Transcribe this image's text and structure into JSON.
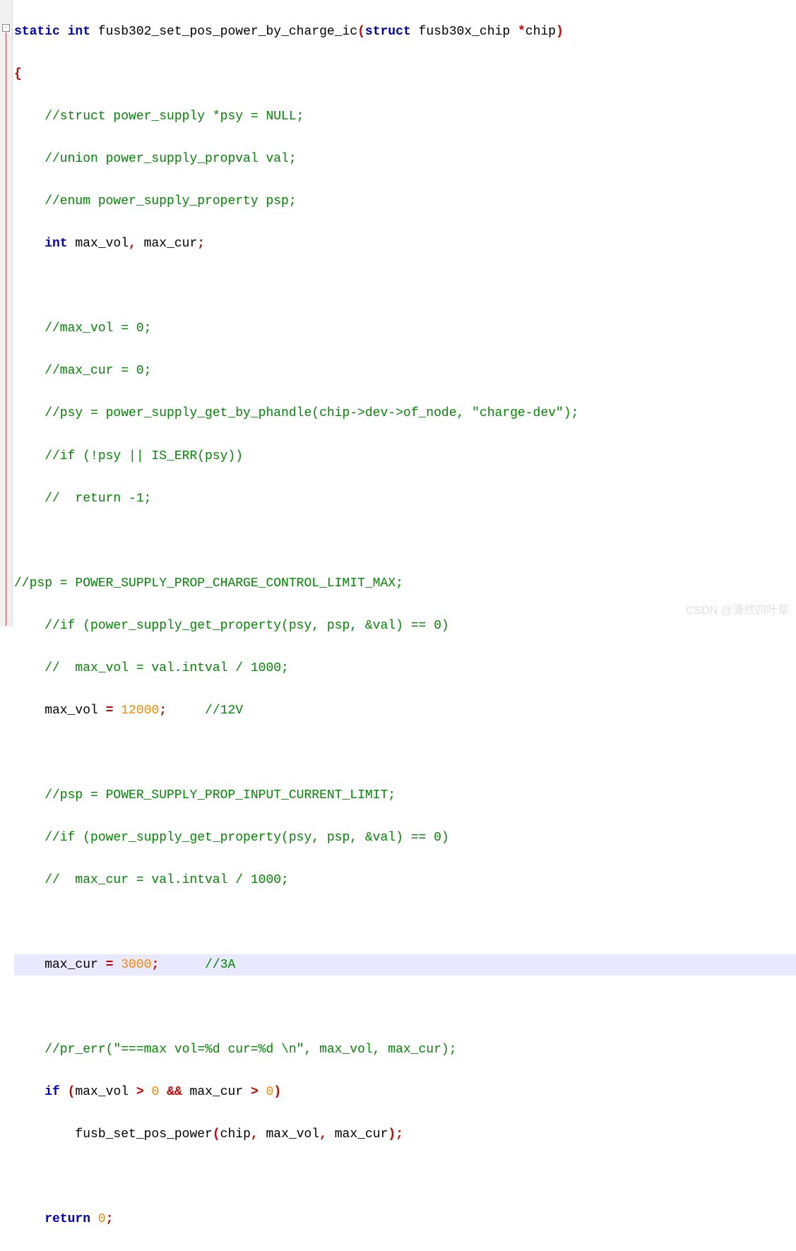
{
  "lines": {
    "l01_static": "static",
    "l01_int": " int",
    "l01_fn": " fusb302_set_pos_power_by_charge_ic",
    "l01_punc1": "(",
    "l01_struct": "struct",
    "l01_type": " fusb30x_chip ",
    "l01_star": "*",
    "l01_param": "chip",
    "l01_punc2": ")",
    "l02_brace": "{",
    "l03": "    //struct power_supply *psy = NULL;",
    "l04": "    //union power_supply_propval val;",
    "l05": "    //enum power_supply_property psp;",
    "l06_int": "    int",
    "l06_vars": " max_vol",
    "l06_comma": ",",
    "l06_vars2": " max_cur",
    "l06_semi": ";",
    "l07": "",
    "l08": "    //max_vol = 0;",
    "l09": "    //max_cur = 0;",
    "l10": "    //psy = power_supply_get_by_phandle(chip->dev->of_node, \"charge-dev\");",
    "l11": "    //if (!psy || IS_ERR(psy))",
    "l12": "    //  return -1;",
    "l13": "",
    "l14": "//psp = POWER_SUPPLY_PROP_CHARGE_CONTROL_LIMIT_MAX;",
    "l15": "    //if (power_supply_get_property(psy, psp, &val) == 0)",
    "l16": "    //  max_vol = val.intval / 1000;",
    "l17_var": "    max_vol ",
    "l17_eq": "=",
    "l17_sp": " ",
    "l17_val": "12000",
    "l17_semi": ";",
    "l17_cmt": "     //12V",
    "l18": "",
    "l19": "    //psp = POWER_SUPPLY_PROP_INPUT_CURRENT_LIMIT;",
    "l20": "    //if (power_supply_get_property(psy, psp, &val) == 0)",
    "l21": "    //  max_cur = val.intval / 1000;",
    "l22": "",
    "l23_var": "    max_cur ",
    "l23_eq": "=",
    "l23_sp": " ",
    "l23_val": "3000",
    "l23_semi": ";",
    "l23_cmt": "      //3A",
    "l24": "",
    "l25": "    //pr_err(\"===max vol=%d cur=%d \\n\", max_vol, max_cur);",
    "l26_if": "    if",
    "l26_sp1": " ",
    "l26_p1": "(",
    "l26_v1": "max_vol ",
    "l26_gt1": ">",
    "l26_sp2": " ",
    "l26_n1": "0",
    "l26_sp3": " ",
    "l26_and": "&&",
    "l26_v2": " max_cur ",
    "l26_gt2": ">",
    "l26_sp4": " ",
    "l26_n2": "0",
    "l26_p2": ")",
    "l27_fn": "        fusb_set_pos_power",
    "l27_p1": "(",
    "l27_a1": "chip",
    "l27_c1": ",",
    "l27_a2": " max_vol",
    "l27_c2": ",",
    "l27_a3": " max_cur",
    "l27_p2": ");",
    "l28": "",
    "l29_ret": "    return",
    "l29_sp": " ",
    "l29_val": "0",
    "l29_semi": ";",
    "l30": "}"
  },
  "fold_symbol": "-",
  "watermark": "CSDN @潇然四叶草"
}
